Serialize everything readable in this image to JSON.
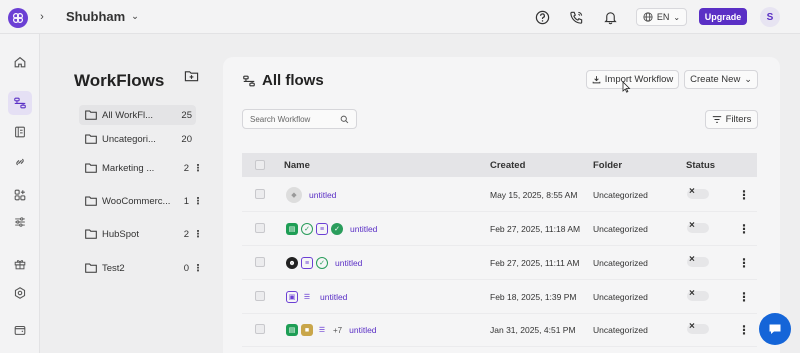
{
  "header": {
    "workspace_name": "Shubham",
    "language": "EN",
    "upgrade_label": "Upgrade",
    "avatar_initial": "S"
  },
  "sidebar_icons": [
    "home-icon",
    "workflows-icon",
    "templates-icon",
    "connections-icon",
    "apps-icon",
    "settings-sliders-icon",
    "gift-icon",
    "hexagon-settings-icon",
    "wallet-icon"
  ],
  "workflows_panel": {
    "title": "WorkFlows",
    "folders": [
      {
        "name": "All WorkFl...",
        "count": "25",
        "menu": false,
        "active": true
      },
      {
        "name": "Uncategori...",
        "count": "20",
        "menu": false,
        "active": false
      },
      {
        "name": "Marketing ...",
        "count": "2",
        "menu": true,
        "active": false
      },
      {
        "name": "WooCommerc...",
        "count": "1",
        "menu": true,
        "active": false
      },
      {
        "name": "HubSpot",
        "count": "2",
        "menu": true,
        "active": false
      },
      {
        "name": "Test2",
        "count": "0",
        "menu": true,
        "active": false
      }
    ]
  },
  "main": {
    "title": "All flows",
    "import_label": "Import Workflow",
    "create_label": "Create New",
    "search_placeholder": "Search Workflow",
    "filters_label": "Filters",
    "columns": {
      "name": "Name",
      "created": "Created",
      "folder": "Folder",
      "status": "Status"
    },
    "rows": [
      {
        "name": "untitled",
        "created": "May 15, 2025, 8:55 AM",
        "folder": "Uncategorized",
        "apps": [
          "placeholder"
        ],
        "more": ""
      },
      {
        "name": "untitled",
        "created": "Feb 27, 2025, 11:18 AM",
        "folder": "Uncategorized",
        "apps": [
          "sheets",
          "check",
          "form",
          "green-check"
        ],
        "more": ""
      },
      {
        "name": "untitled",
        "created": "Feb 27, 2025, 11:11 AM",
        "folder": "Uncategorized",
        "apps": [
          "mailchimp",
          "form",
          "check"
        ],
        "more": ""
      },
      {
        "name": "untitled",
        "created": "Feb 18, 2025, 1:39 PM",
        "folder": "Uncategorized",
        "apps": [
          "image",
          "text"
        ],
        "more": ""
      },
      {
        "name": "untitled",
        "created": "Jan 31, 2025, 4:51 PM",
        "folder": "Uncategorized",
        "apps": [
          "sheets",
          "box",
          "text"
        ],
        "more": "+7"
      }
    ]
  },
  "colors": {
    "accent": "#5a2fc5",
    "chat": "#1565d8"
  }
}
